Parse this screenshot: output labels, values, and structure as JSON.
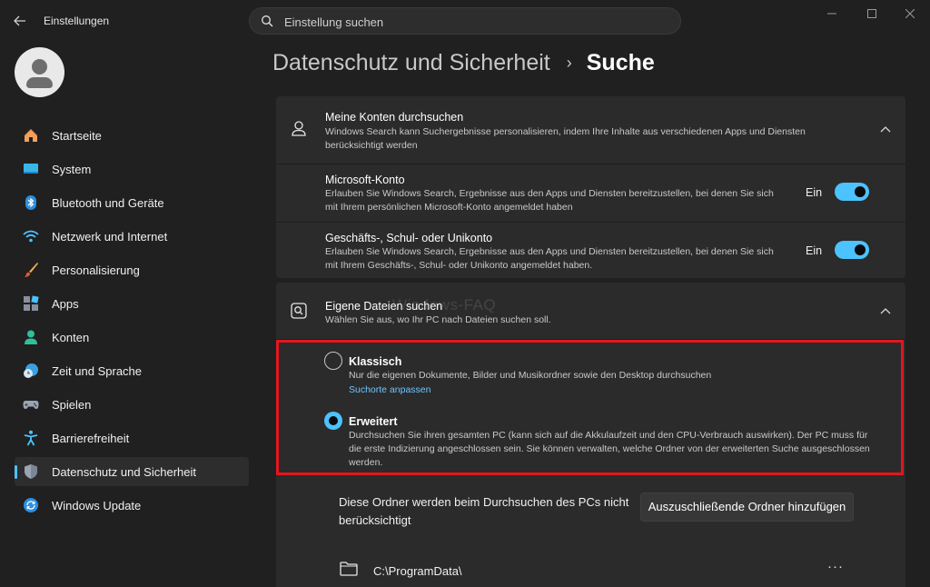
{
  "titlebar": {
    "app_title": "Einstellungen",
    "search_placeholder": "Einstellung suchen"
  },
  "sidebar": {
    "items": [
      {
        "label": "Startseite",
        "icon": "home-icon"
      },
      {
        "label": "System",
        "icon": "monitor-icon"
      },
      {
        "label": "Bluetooth und Geräte",
        "icon": "bluetooth-icon"
      },
      {
        "label": "Netzwerk und Internet",
        "icon": "wifi-icon"
      },
      {
        "label": "Personalisierung",
        "icon": "brush-icon"
      },
      {
        "label": "Apps",
        "icon": "apps-icon"
      },
      {
        "label": "Konten",
        "icon": "person-icon"
      },
      {
        "label": "Zeit und Sprache",
        "icon": "clock-globe-icon"
      },
      {
        "label": "Spielen",
        "icon": "gamepad-icon"
      },
      {
        "label": "Barrierefreiheit",
        "icon": "accessibility-icon"
      },
      {
        "label": "Datenschutz und Sicherheit",
        "icon": "shield-icon",
        "active": true
      },
      {
        "label": "Windows Update",
        "icon": "update-icon"
      }
    ]
  },
  "breadcrumb": {
    "parent": "Datenschutz und Sicherheit",
    "separator": "›",
    "current": "Suche"
  },
  "accounts_card": {
    "title": "Meine Konten durchsuchen",
    "description": "Windows Search kann Suchergebnisse personalisieren, indem Ihre Inhalte aus verschiedenen Apps und Diensten berücksichtigt werden",
    "rows": [
      {
        "title": "Microsoft-Konto",
        "description": "Erlauben Sie Windows Search, Ergebnisse aus den Apps und Diensten bereitzustellen, bei denen Sie sich mit Ihrem persönlichen Microsoft-Konto angemeldet haben",
        "state": "Ein"
      },
      {
        "title": "Geschäfts-, Schul- oder Unikonto",
        "description": "Erlauben Sie Windows Search, Ergebnisse aus den Apps und Diensten bereitzustellen, bei denen Sie sich mit Ihrem Geschäfts-, Schul- oder Unikonto angemeldet haben.",
        "state": "Ein"
      }
    ]
  },
  "files_card": {
    "title": "Eigene Dateien suchen",
    "description": "Wählen Sie aus, wo Ihr PC nach Dateien suchen soll.",
    "options": [
      {
        "title": "Klassisch",
        "description": "Nur die eigenen Dokumente, Bilder und Musikordner sowie den Desktop durchsuchen",
        "link": "Suchorte anpassen",
        "selected": false
      },
      {
        "title": "Erweitert",
        "description": "Durchsuchen Sie ihren gesamten PC (kann sich auf die Akkulaufzeit und den CPU-Verbrauch auswirken). Der PC muss für die erste Indizierung angeschlossen sein. Sie können verwalten, welche Ordner von der erweiterten Suche ausgeschlossen werden.",
        "selected": true
      }
    ]
  },
  "excluded": {
    "text": "Diese Ordner werden beim Durchsuchen des PCs nicht berücksichtigt",
    "button": "Auszuschließende Ordner hinzufügen",
    "folders": [
      "C:\\ProgramData\\"
    ],
    "more": "···"
  },
  "watermark": "Windows-FAQ",
  "colors": {
    "accent": "#4cc2ff",
    "highlight_border": "#e3161f",
    "background": "#202020",
    "card": "#2b2b2b"
  }
}
